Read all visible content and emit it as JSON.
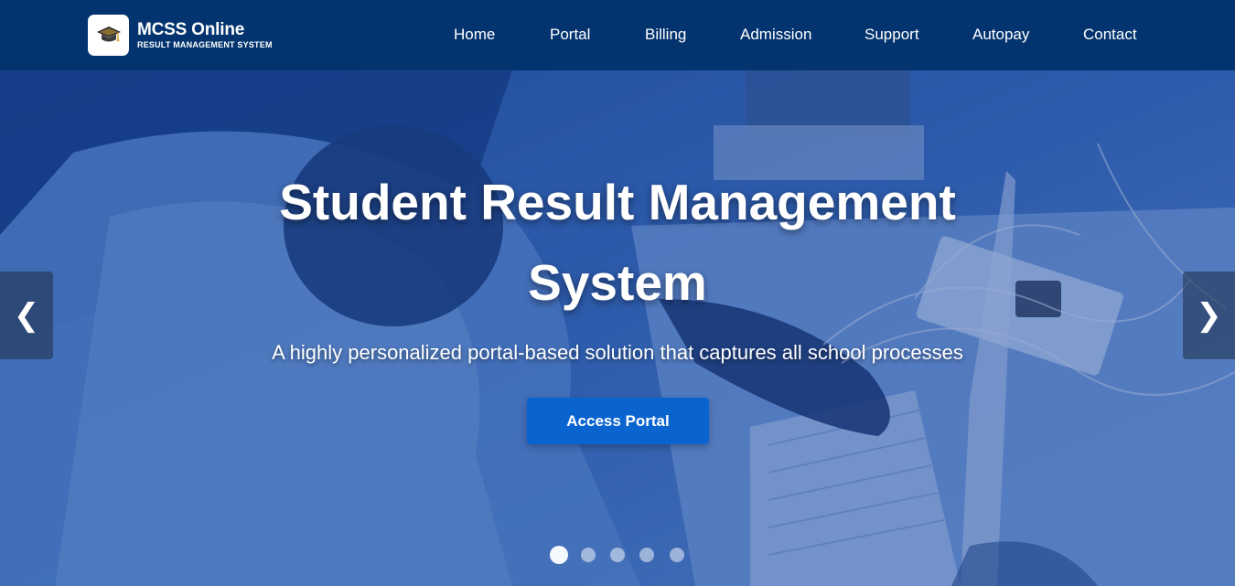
{
  "brand": {
    "name": "MCSS Online",
    "tagline": "RESULT MANAGEMENT SYSTEM",
    "logo_icon": "graduation-cap-icon"
  },
  "nav": {
    "items": [
      {
        "label": "Home"
      },
      {
        "label": "Portal"
      },
      {
        "label": "Billing"
      },
      {
        "label": "Admission"
      },
      {
        "label": "Support"
      },
      {
        "label": "Autopay"
      },
      {
        "label": "Contact"
      }
    ]
  },
  "hero": {
    "title_line1": "Student Result Management",
    "title_line2": "System",
    "subtitle": "A highly personalized portal-based solution that captures all school processes",
    "cta_label": "Access Portal",
    "prev_icon": "❮",
    "next_icon": "❯",
    "slide_count": 5,
    "active_slide": 1
  },
  "colors": {
    "header_bg": "#04346f",
    "cta_bg": "#0a64cf",
    "text": "#ffffff"
  }
}
